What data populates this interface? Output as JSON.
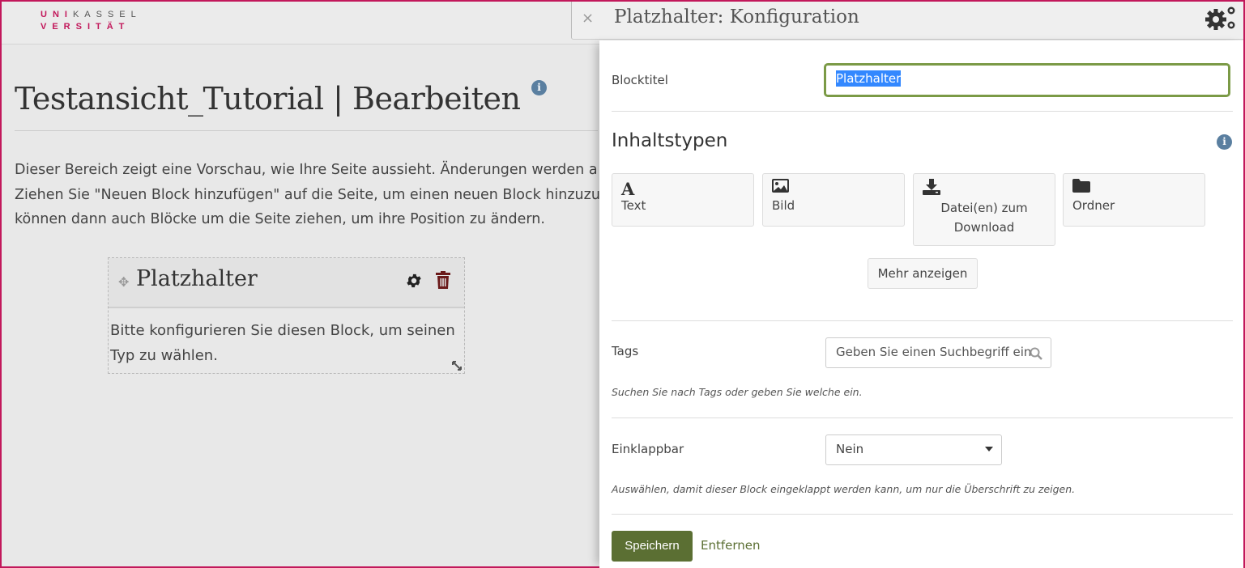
{
  "logo": {
    "line1_pink": "UNI",
    "line1_gray": "KASSEL",
    "line2": "VERSITÄT"
  },
  "page": {
    "title": "Testansicht_Tutorial | Bearbeiten",
    "intro_lines": [
      "Dieser Bereich zeigt eine Vorschau, wie Ihre Seite aussieht. Änderungen werden a",
      "Ziehen Sie \"Neuen Block hinzufügen\" auf die Seite, um einen neuen Block hinzuzu",
      "können dann auch Blöcke um die Seite ziehen, um ihre Position zu ändern."
    ]
  },
  "block": {
    "title": "Platzhalter",
    "body": "Bitte konfigurieren Sie diesen Block, um seinen Typ zu wählen."
  },
  "panel": {
    "close_label": "×",
    "title": "Platzhalter: Konfiguration",
    "blocktitle_label": "Blocktitel",
    "blocktitle_value": "Platzhalter",
    "content_types_title": "Inhaltstypen",
    "content_types": [
      {
        "icon": "text-icon",
        "label": "Text"
      },
      {
        "icon": "image-icon",
        "label": "Bild"
      },
      {
        "icon": "download-icon",
        "label": "Datei(en) zum Download"
      },
      {
        "icon": "folder-icon",
        "label": "Ordner"
      }
    ],
    "more_label": "Mehr anzeigen",
    "tags_label": "Tags",
    "tags_placeholder": "Geben Sie einen Suchbegriff ein",
    "tags_hint": "Suchen Sie nach Tags oder geben Sie welche ein.",
    "collapsible_label": "Einklappbar",
    "collapsible_value": "Nein",
    "collapsible_hint": "Auswählen, damit dieser Block eingeklappt werden kann, um nur die Überschrift zu zeigen.",
    "save_label": "Speichern",
    "remove_label": "Entfernen"
  },
  "colors": {
    "brand": "#c2185b",
    "accent": "#5b6f33",
    "focus": "#7b9a46",
    "info": "#5a7fa0"
  }
}
